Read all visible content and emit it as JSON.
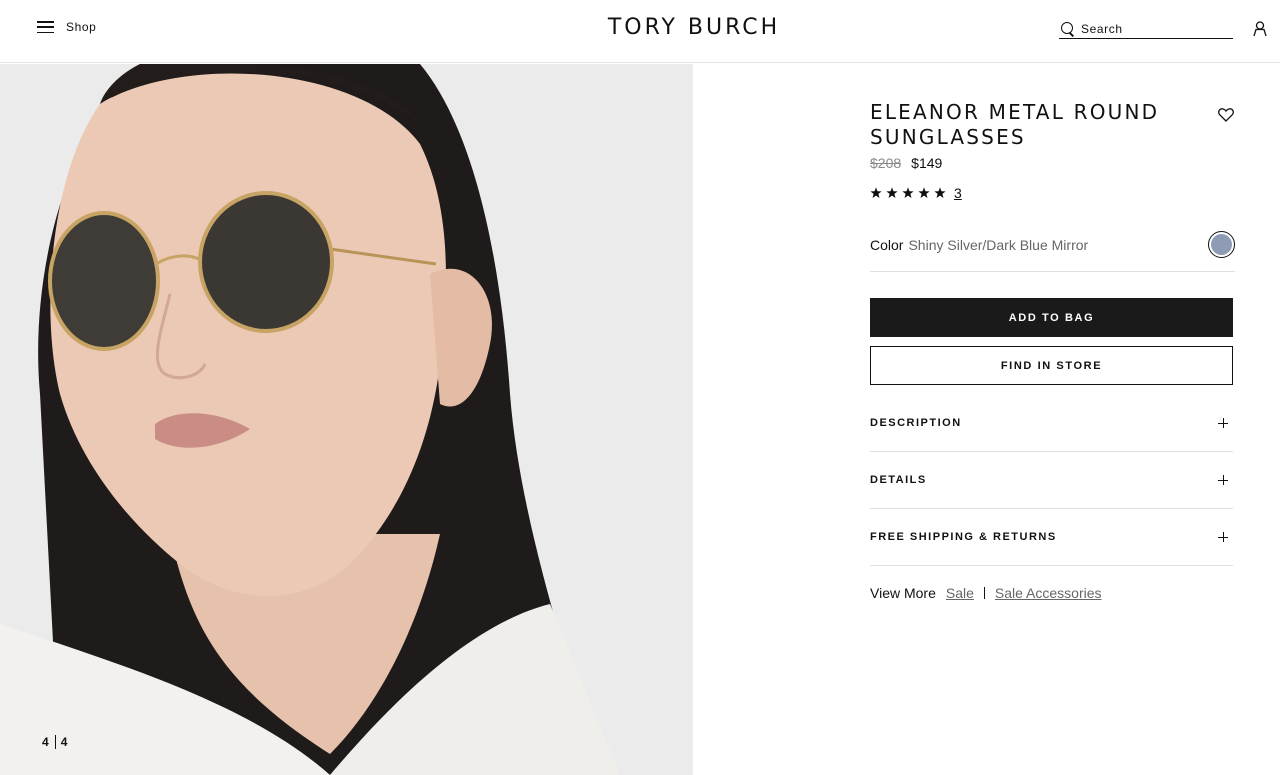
{
  "header": {
    "menu_label": "Shop",
    "logo_text": "TORY BURCH",
    "search_placeholder": "Search"
  },
  "gallery": {
    "current_page": "4",
    "total_pages": "4"
  },
  "product": {
    "title": "ELEANOR METAL ROUND SUNGLASSES",
    "original_price": "$208",
    "sale_price": "$149",
    "rating_stars": 5,
    "review_count": "3",
    "color_label": "Color",
    "color_value": "Shiny Silver/Dark Blue Mirror",
    "swatch_color": "#8e9bb4",
    "add_to_bag_label": "ADD TO BAG",
    "find_in_store_label": "FIND IN STORE"
  },
  "accordion": [
    {
      "label": "DESCRIPTION"
    },
    {
      "label": "DETAILS"
    },
    {
      "label": "FREE SHIPPING & RETURNS"
    }
  ],
  "view_more": {
    "label": "View More",
    "links": [
      "Sale",
      "Sale Accessories"
    ]
  },
  "icons": [
    "menu-icon",
    "search-icon",
    "account-icon",
    "heart-icon",
    "star-icon",
    "plus-icon"
  ]
}
